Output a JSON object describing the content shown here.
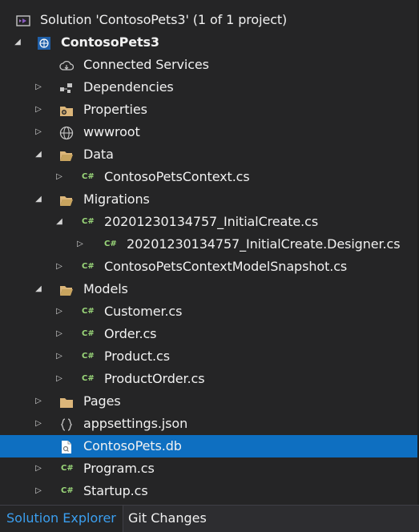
{
  "solution": {
    "label": "Solution 'ContosoPets3' (1 of 1 project)"
  },
  "project": {
    "label": "ContosoPets3"
  },
  "items": {
    "connected_services": "Connected Services",
    "dependencies": "Dependencies",
    "properties": "Properties",
    "wwwroot": "wwwroot",
    "data": "Data",
    "data_context": "ContosoPetsContext.cs",
    "migrations": "Migrations",
    "initial_create": "20201230134757_InitialCreate.cs",
    "initial_create_designer": "20201230134757_InitialCreate.Designer.cs",
    "snapshot": "ContosoPetsContextModelSnapshot.cs",
    "models": "Models",
    "customer": "Customer.cs",
    "order": "Order.cs",
    "product": "Product.cs",
    "product_order": "ProductOrder.cs",
    "pages": "Pages",
    "appsettings": "appsettings.json",
    "db": "ContosoPets.db",
    "program": "Program.cs",
    "startup": "Startup.cs"
  },
  "cs_badge": "C#",
  "tabs": {
    "solution_explorer": "Solution Explorer",
    "git_changes": "Git Changes"
  },
  "colors": {
    "selected": "#0e6fc1",
    "folder": "#dcb67a",
    "csharp": "#9bd87a",
    "active_tab": "#3b9fef"
  }
}
